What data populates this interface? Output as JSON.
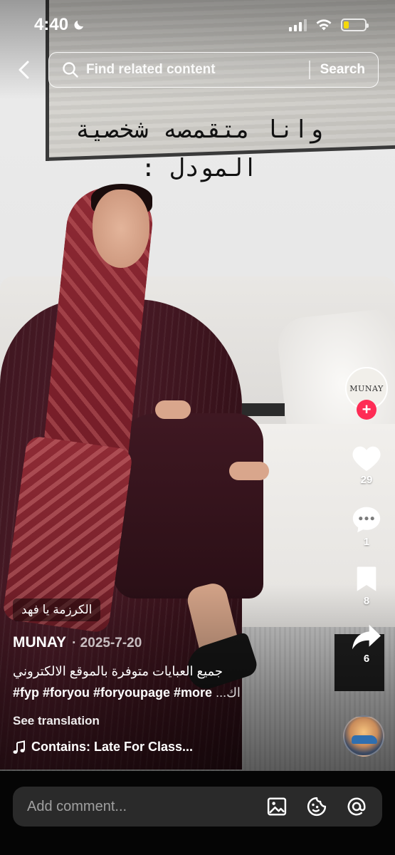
{
  "status_bar": {
    "time": "4:40",
    "battery_level": 0.25,
    "battery_color": "#f5d90a"
  },
  "search": {
    "placeholder": "Find related content",
    "button_label": "Search"
  },
  "video": {
    "overlay_line1": "وانا متقمصه شخصية",
    "overlay_line2": "المودل :"
  },
  "rail": {
    "avatar_text": "MUNAY",
    "follow_label": "+",
    "likes": "29",
    "comments": "1",
    "saves": "8",
    "shares": "6",
    "accent_color": "#fe2c55"
  },
  "caption": {
    "sticker": "الكرزمة يا فهد",
    "author": "MUNAY",
    "date": "· 2025-7-20",
    "description_arabic": "جميع العبايات متوفرة بالموقع الالكتروني",
    "hashtags": "#fyp #foryou #foryoupage #more",
    "more": " ...اك",
    "see_translation": "See translation",
    "music": "Contains: Late For Class..."
  },
  "comment_bar": {
    "placeholder": "Add comment..."
  },
  "icons": {
    "back": "chevron-left-icon",
    "search": "search-icon",
    "like": "heart-icon",
    "comment": "comment-bubble-icon",
    "save": "bookmark-icon",
    "share": "share-arrow-icon",
    "music": "music-note-icon",
    "image": "image-icon",
    "emoji": "emoji-icon",
    "mention": "at-sign-icon"
  }
}
